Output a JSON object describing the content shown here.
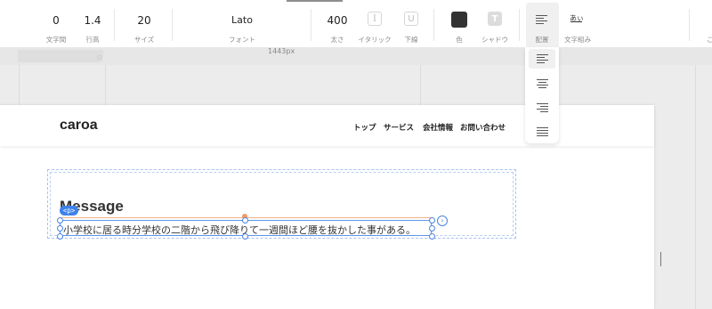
{
  "toolbar": {
    "letter_spacing": {
      "value": "0",
      "label": "文字間"
    },
    "line_height": {
      "value": "1.4",
      "label": "行高"
    },
    "size": {
      "value": "20",
      "label": "サイズ"
    },
    "font": {
      "value": "Lato",
      "label": "フォント"
    },
    "weight": {
      "value": "400",
      "label": "太さ"
    },
    "italic": {
      "icon": "I",
      "label": "イタリック"
    },
    "underline": {
      "icon": "U",
      "label": "下線"
    },
    "color": {
      "label": "色",
      "swatch": "#333333"
    },
    "shadow": {
      "icon": "T",
      "label": "シャドウ"
    },
    "align": {
      "label": "配置"
    },
    "writing": {
      "icon": "あぃ",
      "label": "文字組み"
    }
  },
  "ruler": {
    "width_label": "1443px"
  },
  "align_options": [
    "left",
    "center",
    "right",
    "justify"
  ],
  "selected_align": "left",
  "site": {
    "logo": "caroa",
    "nav": [
      "トップ",
      "サービス",
      "会社情報",
      "お問い合わせ"
    ]
  },
  "section": {
    "heading": "Message",
    "tag": "<p>",
    "paragraph": "小学校に居る時分学校の二階から飛び降りて一週間ほど腰を抜かした事がある。"
  },
  "colors": {
    "selection": "#3d82ec",
    "accent_orange": "#f09a64"
  }
}
